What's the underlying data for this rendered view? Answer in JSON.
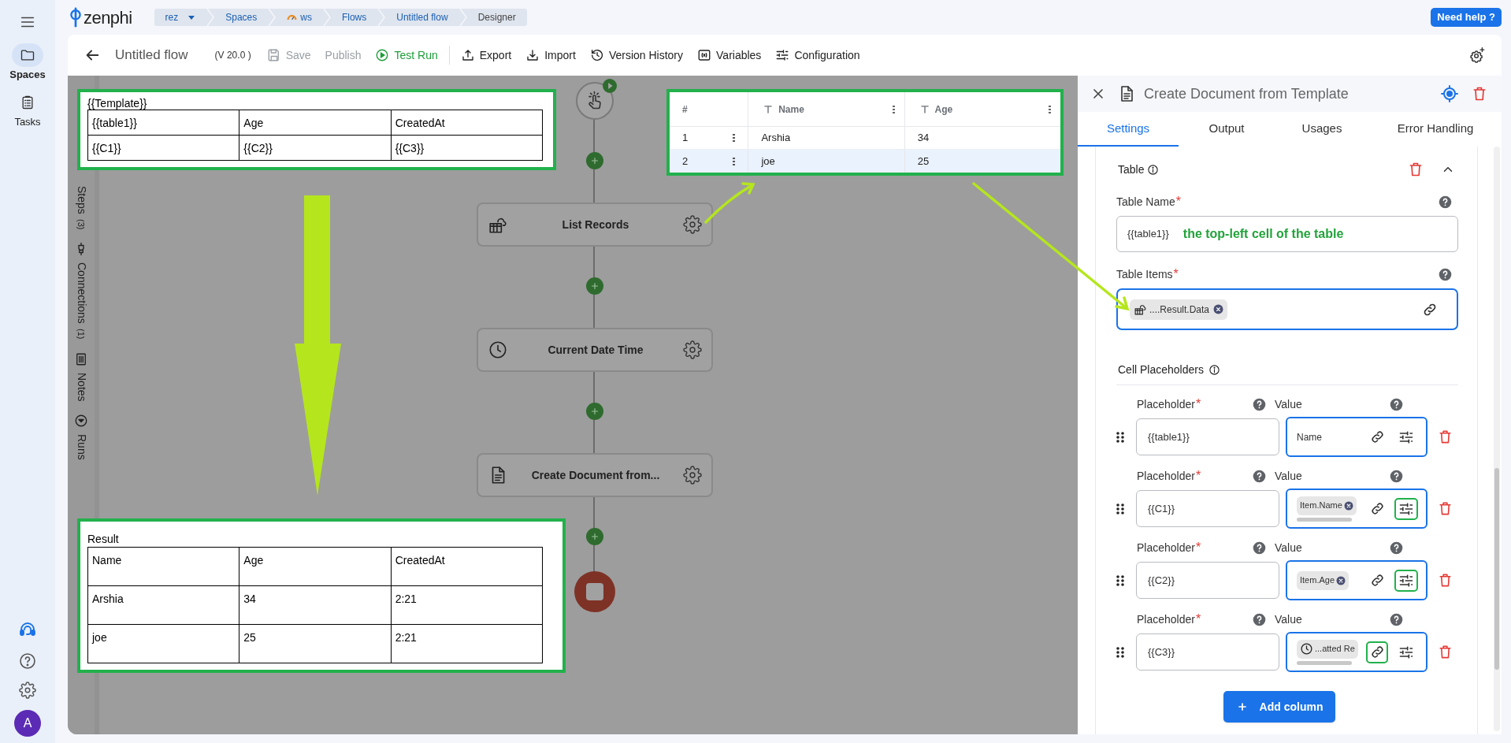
{
  "sidebar": {
    "items": [
      {
        "label": "Spaces",
        "selected": true
      },
      {
        "label": "Tasks",
        "selected": false
      }
    ],
    "avatar": "A"
  },
  "logo": "zenphi",
  "breadcrumbs": [
    {
      "label": "rez",
      "kind": "menu"
    },
    {
      "label": "Spaces",
      "kind": "link"
    },
    {
      "label": "ws",
      "kind": "space"
    },
    {
      "label": "Flows",
      "kind": "link"
    },
    {
      "label": "Untitled flow",
      "kind": "link"
    },
    {
      "label": "Designer",
      "kind": "current"
    }
  ],
  "help_button": "Need help ?",
  "toolbar": {
    "title": "Untitled flow",
    "version": "(V 20.0 )",
    "action_groups": [
      [
        {
          "label": "Save",
          "disabled": true,
          "kind": "plain"
        },
        {
          "label": "Publish",
          "disabled": true,
          "kind": "plain"
        },
        {
          "label": "Test Run",
          "disabled": false,
          "kind": "run"
        }
      ],
      [
        {
          "label": "Export",
          "disabled": false,
          "kind": "plain"
        },
        {
          "label": "Import",
          "disabled": false,
          "kind": "plain"
        },
        {
          "label": "Version History",
          "disabled": false,
          "kind": "plain"
        },
        {
          "label": "Variables",
          "disabled": false,
          "kind": "plain"
        },
        {
          "label": "Configuration",
          "disabled": false,
          "kind": "plain"
        }
      ]
    ]
  },
  "canvas_tabs": [
    {
      "label": "Steps",
      "count": "(3)"
    },
    {
      "label": "Connections",
      "count": "(1)"
    },
    {
      "label": "Notes"
    },
    {
      "label": "Runs"
    }
  ],
  "flow": {
    "steps": [
      {
        "label": "List Records"
      },
      {
        "label": "Current Date Time"
      },
      {
        "label": "Create Document from..."
      }
    ]
  },
  "annotations": {
    "template_table": {
      "title": "{{Template}}",
      "rows": [
        [
          "{{table1}}",
          "Age",
          "CreatedAt"
        ],
        [
          "{{C1}}",
          "{{C2}}",
          "{{C3}}"
        ]
      ]
    },
    "records_grid": {
      "columns": [
        "#",
        "Name",
        "Age"
      ],
      "rows": [
        {
          "cells": [
            "1",
            "Arshia",
            "34"
          ],
          "selected": false
        },
        {
          "cells": [
            "2",
            "joe",
            "25"
          ],
          "selected": true
        }
      ]
    },
    "result_table": {
      "title": "Result",
      "rows": [
        [
          "Name",
          "Age",
          "CreatedAt"
        ],
        [
          "Arshia",
          "34",
          "2:21"
        ],
        [
          "joe",
          "25",
          "2:21"
        ]
      ]
    }
  },
  "panel": {
    "title": "Create Document from Template",
    "tabs": [
      {
        "label": "Settings",
        "selected": true
      },
      {
        "label": "Output",
        "selected": false
      },
      {
        "label": "Usages",
        "selected": false
      },
      {
        "label": "Error Handling",
        "selected": false
      }
    ],
    "section": {
      "title": "Table",
      "expanded": true
    },
    "table_name": {
      "label": "Table Name",
      "required_mark": "*",
      "value": "{{table1}}",
      "note": "the top-left cell of the table"
    },
    "table_items": {
      "label": "Table Items",
      "required_mark": "*",
      "chip": "....Result.Data"
    },
    "cell_placeholders": {
      "label": "Cell Placeholders",
      "rows": [
        {
          "placeholder_label": "Placeholder",
          "required_mark": "*",
          "value_label": "Value",
          "placeholder": "{{table1}}",
          "value": {
            "kind": "text",
            "text": "Name"
          },
          "link_highlighted": false,
          "options_highlighted": false
        },
        {
          "placeholder_label": "Placeholder",
          "required_mark": "*",
          "value_label": "Value",
          "placeholder": "{{C1}}",
          "value": {
            "kind": "chip",
            "text": "Item.Name",
            "removable": true,
            "scroll": true
          },
          "link_highlighted": false,
          "options_highlighted": true
        },
        {
          "placeholder_label": "Placeholder",
          "required_mark": "*",
          "value_label": "Value",
          "placeholder": "{{C2}}",
          "value": {
            "kind": "chip",
            "text": "Item.Age",
            "removable": true,
            "scroll": false
          },
          "link_highlighted": false,
          "options_highlighted": true
        },
        {
          "placeholder_label": "Placeholder",
          "required_mark": "*",
          "value_label": "Value",
          "placeholder": "{{C3}}",
          "value": {
            "kind": "step-chip",
            "text": "...atted Re",
            "removable": false,
            "scroll": true
          },
          "link_highlighted": true,
          "options_highlighted": false
        }
      ]
    },
    "add_button": "Add column"
  }
}
